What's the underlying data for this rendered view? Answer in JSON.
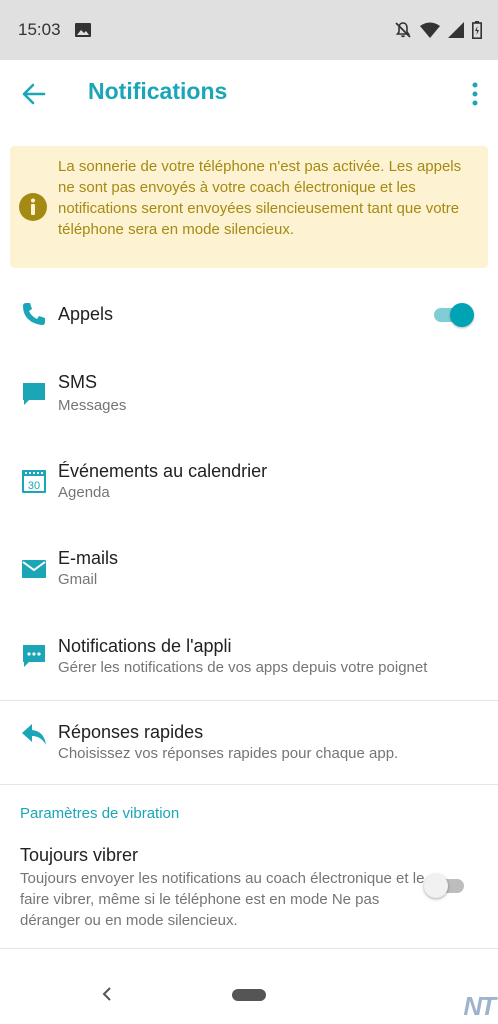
{
  "status_bar": {
    "time": "15:03"
  },
  "app_bar": {
    "title": "Notifications"
  },
  "warning": {
    "text": "La sonnerie de votre téléphone n'est pas activée. Les appels ne sont pas envoyés à votre coach électronique et les notifications seront envoyées silencieusement tant que votre téléphone sera en mode silencieux."
  },
  "items": [
    {
      "primary": "Appels",
      "secondary": "",
      "icon": "phone-icon",
      "toggle": true
    },
    {
      "primary": "SMS",
      "secondary": "Messages",
      "icon": "sms-icon"
    },
    {
      "primary": "Événements au calendrier",
      "secondary": "Agenda",
      "icon": "calendar-icon"
    },
    {
      "primary": "E-mails",
      "secondary": "Gmail",
      "icon": "email-icon"
    },
    {
      "primary": "Notifications de l'appli",
      "secondary": "Gérer les notifications de vos apps depuis votre poignet",
      "icon": "app-notification-icon"
    },
    {
      "primary": "Réponses rapides",
      "secondary": "Choisissez vos réponses rapides pour chaque app.",
      "icon": "reply-icon"
    }
  ],
  "calendar_icon_day": "30",
  "vibration": {
    "section_header": "Paramètres de vibration",
    "title": "Toujours vibrer",
    "description": "Toujours envoyer les notifications au coach électronique et le faire vibrer, même si le téléphone est en mode Ne pas déranger ou en mode silencieux.",
    "enabled": false
  },
  "watermark": "NT",
  "colors": {
    "accent": "#1aa6b7",
    "warning_bg": "#fdf3d2",
    "warning_text": "#a48a12"
  }
}
